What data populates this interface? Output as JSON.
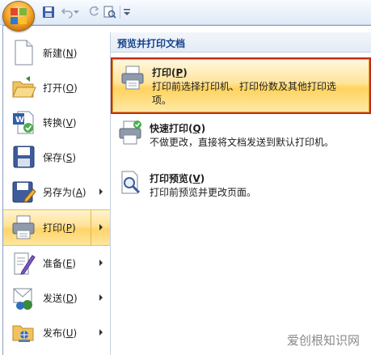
{
  "menu": {
    "left_items": [
      {
        "label": "新建",
        "key": "N",
        "has_submenu": false,
        "active": false,
        "icon": "new-document-icon"
      },
      {
        "label": "打开",
        "key": "O",
        "has_submenu": false,
        "active": false,
        "icon": "open-folder-icon"
      },
      {
        "label": "转换",
        "key": "V",
        "has_submenu": false,
        "active": false,
        "icon": "convert-icon"
      },
      {
        "label": "保存",
        "key": "S",
        "has_submenu": false,
        "active": false,
        "icon": "save-icon"
      },
      {
        "label": "另存为",
        "key": "A",
        "has_submenu": true,
        "active": false,
        "icon": "save-as-icon"
      },
      {
        "label": "打印",
        "key": "P",
        "has_submenu": true,
        "active": true,
        "icon": "print-icon"
      },
      {
        "label": "准备",
        "key": "E",
        "has_submenu": true,
        "active": false,
        "icon": "prepare-icon"
      },
      {
        "label": "发送",
        "key": "D",
        "has_submenu": true,
        "active": false,
        "icon": "send-icon"
      },
      {
        "label": "发布",
        "key": "U",
        "has_submenu": true,
        "active": false,
        "icon": "publish-icon"
      }
    ]
  },
  "submenu": {
    "header": "预览并打印文档",
    "options": [
      {
        "title": "打印",
        "key": "P",
        "desc_line1": "打印前选择打印机、打印份数及其他打印选",
        "desc_line2": "项。",
        "icon": "printer-icon",
        "active": true
      },
      {
        "title": "快速打印",
        "key": "Q",
        "desc_line1": "不做更改，直接将文档发送到默认打印机。",
        "desc_line2": "",
        "icon": "quick-print-icon",
        "active": false
      },
      {
        "title": "打印预览",
        "key": "V",
        "desc_line1": "打印前预览并更改页面。",
        "desc_line2": "",
        "icon": "print-preview-icon",
        "active": false
      }
    ]
  },
  "watermark": "爱创根知识网",
  "colors": {
    "highlight_border": "#c62a1c",
    "accent_text": "#15428b",
    "hover_gold": "#ffd46a"
  }
}
